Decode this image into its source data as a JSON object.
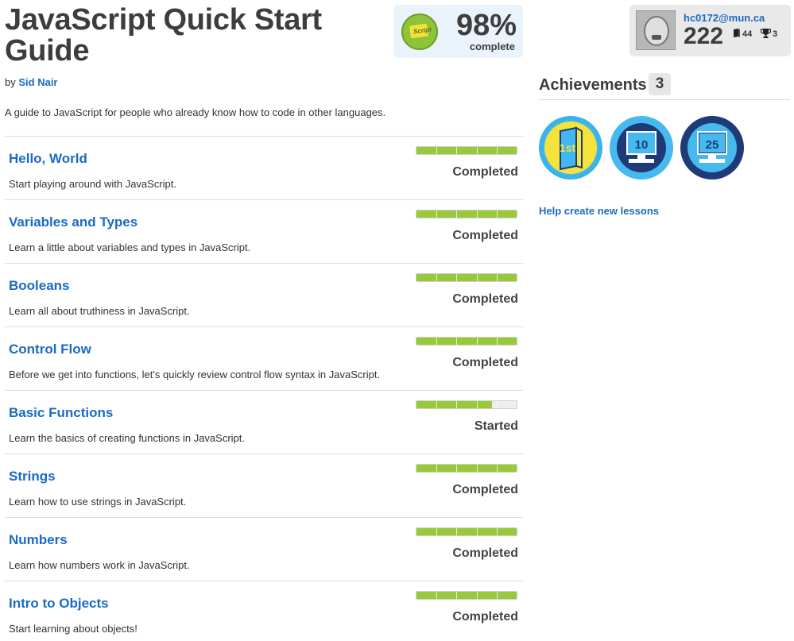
{
  "course": {
    "title": "JavaScript Quick Start Guide",
    "author_prefix": "by",
    "author": "Sid Nair",
    "description": "A guide to JavaScript for people who already know how to code in other languages.",
    "progress": {
      "percent": "98%",
      "label": "complete",
      "badge_text": "Script"
    }
  },
  "lessons": [
    {
      "title": "Hello, World",
      "description": "Start playing around with JavaScript.",
      "status": "Completed",
      "progress": 1.0
    },
    {
      "title": "Variables and Types",
      "description": "Learn a little about variables and types in JavaScript.",
      "status": "Completed",
      "progress": 1.0
    },
    {
      "title": "Booleans",
      "description": "Learn all about truthiness in JavaScript.",
      "status": "Completed",
      "progress": 1.0
    },
    {
      "title": "Control Flow",
      "description": "Before we get into functions, let's quickly review control flow syntax in JavaScript.",
      "status": "Completed",
      "progress": 1.0
    },
    {
      "title": "Basic Functions",
      "description": "Learn the basics of creating functions in JavaScript.",
      "status": "Started",
      "progress": 0.75
    },
    {
      "title": "Strings",
      "description": "Learn how to use strings in JavaScript.",
      "status": "Completed",
      "progress": 1.0
    },
    {
      "title": "Numbers",
      "description": "Learn how numbers work in JavaScript.",
      "status": "Completed",
      "progress": 1.0
    },
    {
      "title": "Intro to Objects",
      "description": "Start learning about objects!",
      "status": "Completed",
      "progress": 1.0
    }
  ],
  "user": {
    "email": "hc0172@mun.ca",
    "points": "222",
    "lessons_count": "44",
    "trophies_count": "3"
  },
  "achievements": {
    "title": "Achievements",
    "count": "3",
    "badges": [
      {
        "label": "1st",
        "icon": "first-lesson-book-icon"
      },
      {
        "label": "10",
        "icon": "monitor-10-icon"
      },
      {
        "label": "25",
        "icon": "monitor-25-icon"
      }
    ]
  },
  "help_link": "Help create new lessons",
  "colors": {
    "link": "#1a6bc4",
    "progress_fill": "#99c93a",
    "progress_track": "#eeeeee",
    "badge_light_blue": "#40b7ee",
    "badge_dark_blue": "#1e3b77",
    "badge_yellow": "#f5e33b"
  }
}
